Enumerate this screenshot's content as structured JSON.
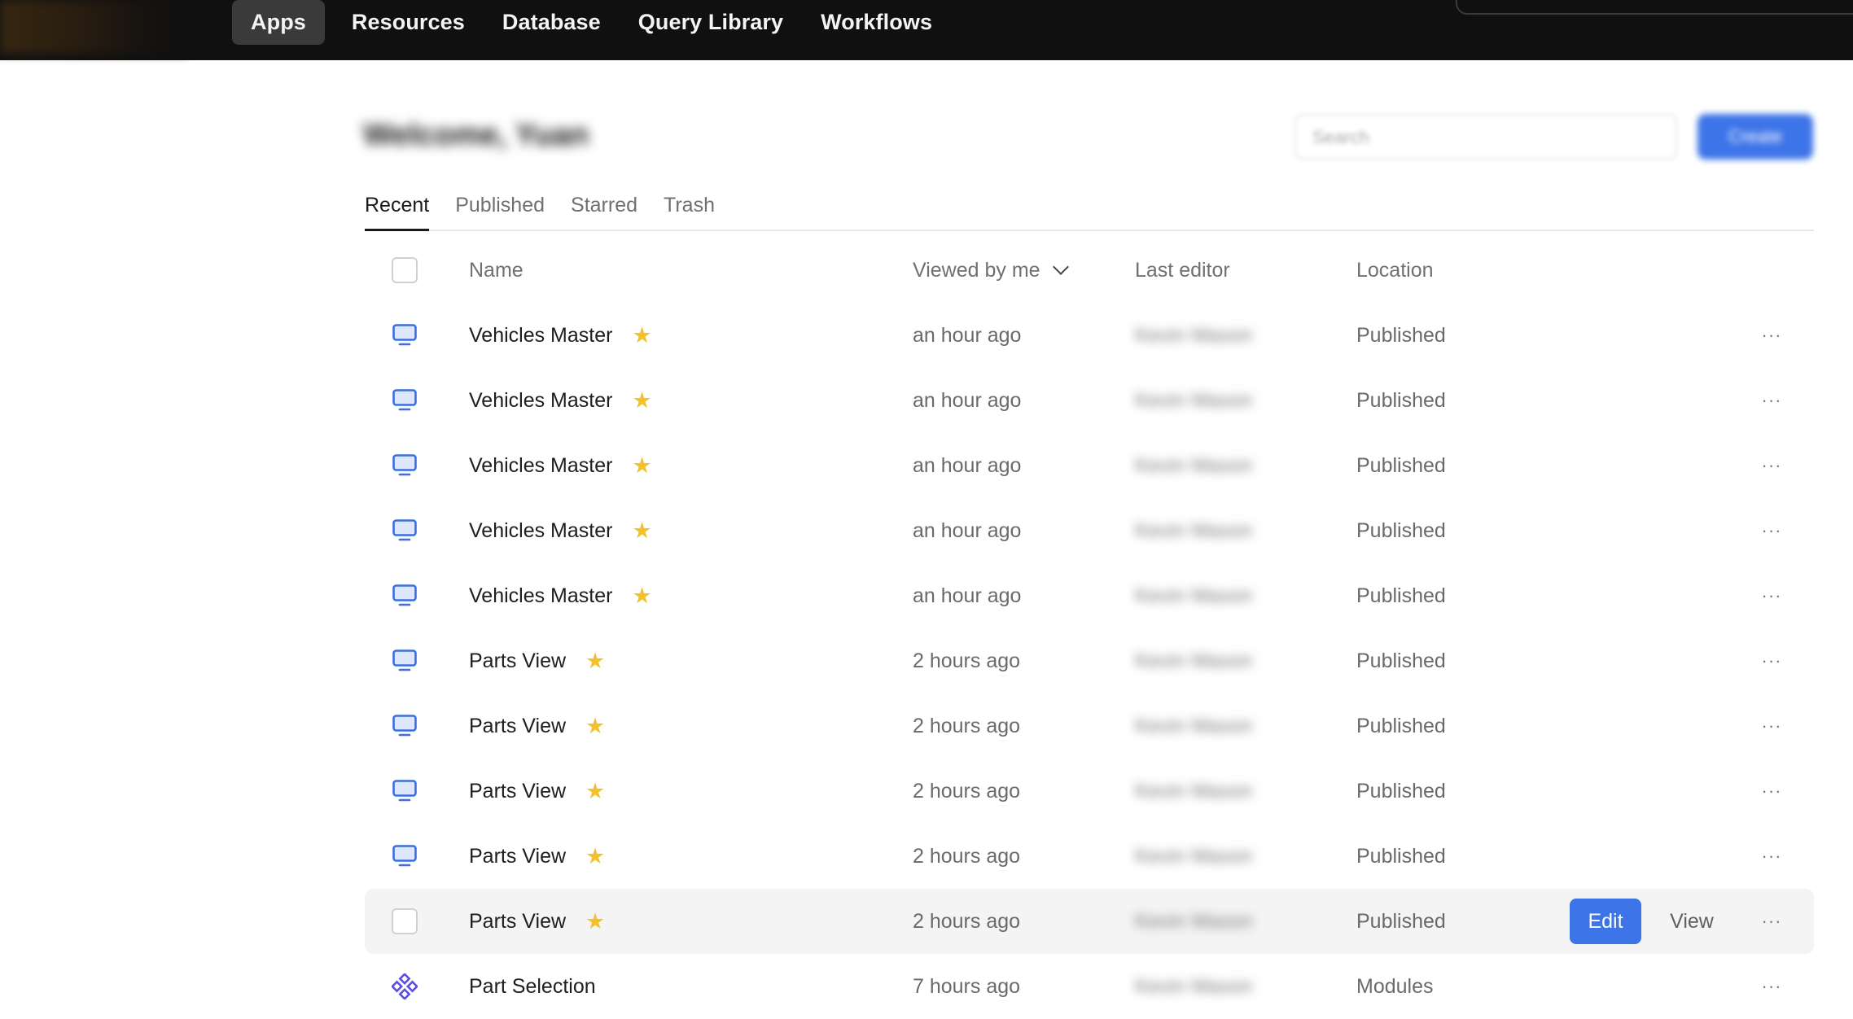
{
  "nav": {
    "items": [
      {
        "label": "Apps",
        "active": true
      },
      {
        "label": "Resources",
        "active": false
      },
      {
        "label": "Database",
        "active": false
      },
      {
        "label": "Query Library",
        "active": false
      },
      {
        "label": "Workflows",
        "active": false
      }
    ]
  },
  "header": {
    "title": "Welcome, Yuan",
    "search_placeholder": "Search",
    "create_label": "Create"
  },
  "tabs": [
    {
      "label": "Recent",
      "active": true
    },
    {
      "label": "Published",
      "active": false
    },
    {
      "label": "Starred",
      "active": false
    },
    {
      "label": "Trash",
      "active": false
    }
  ],
  "table": {
    "columns": {
      "name": "Name",
      "viewed": "Viewed by me",
      "editor": "Last editor",
      "location": "Location"
    },
    "row_actions": {
      "edit": "Edit",
      "view": "View",
      "more": "···"
    },
    "rows": [
      {
        "icon": "monitor-icon",
        "name": "Vehicles Master",
        "starred": true,
        "viewed": "an hour ago",
        "editor": "Kevin Mason",
        "location": "Published"
      },
      {
        "icon": "monitor-icon",
        "name": "Vehicles Master",
        "starred": true,
        "viewed": "an hour ago",
        "editor": "Kevin Mason",
        "location": "Published"
      },
      {
        "icon": "monitor-icon",
        "name": "Vehicles Master",
        "starred": true,
        "viewed": "an hour ago",
        "editor": "Kevin Mason",
        "location": "Published"
      },
      {
        "icon": "monitor-icon",
        "name": "Vehicles Master",
        "starred": true,
        "viewed": "an hour ago",
        "editor": "Kevin Mason",
        "location": "Published"
      },
      {
        "icon": "monitor-icon",
        "name": "Vehicles Master",
        "starred": true,
        "viewed": "an hour ago",
        "editor": "Kevin Mason",
        "location": "Published"
      },
      {
        "icon": "monitor-icon",
        "name": "Parts View",
        "starred": true,
        "viewed": "2 hours ago",
        "editor": "Kevin Mason",
        "location": "Published"
      },
      {
        "icon": "monitor-icon",
        "name": "Parts View",
        "starred": true,
        "viewed": "2 hours ago",
        "editor": "Kevin Mason",
        "location": "Published"
      },
      {
        "icon": "monitor-icon",
        "name": "Parts View",
        "starred": true,
        "viewed": "2 hours ago",
        "editor": "Kevin Mason",
        "location": "Published"
      },
      {
        "icon": "monitor-icon",
        "name": "Parts View",
        "starred": true,
        "viewed": "2 hours ago",
        "editor": "Kevin Mason",
        "location": "Published"
      },
      {
        "icon": "checkbox",
        "name": "Parts View",
        "starred": true,
        "viewed": "2 hours ago",
        "editor": "Kevin Mason",
        "location": "Published",
        "hovered": true
      },
      {
        "icon": "module-icon",
        "name": "Part Selection",
        "starred": false,
        "viewed": "7 hours ago",
        "editor": "Kevin Mason",
        "location": "Modules"
      }
    ]
  },
  "colors": {
    "topbar": "#101010",
    "accent": "#3d74e8",
    "star": "#f2c12e",
    "icon": "#3d6ee0"
  }
}
